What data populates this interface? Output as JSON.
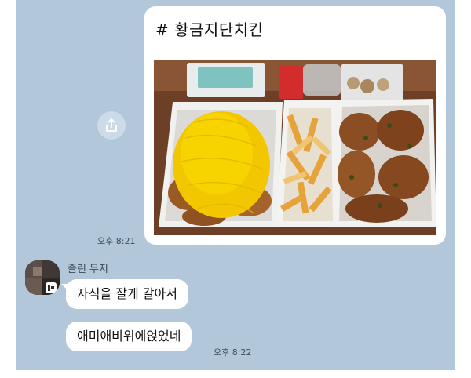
{
  "shared_card": {
    "title": "# 황금지단치킨",
    "time": "오후 8:21"
  },
  "incoming": {
    "sender": "졸린 무지",
    "messages": [
      {
        "text": "자식을 잘게 갈아서"
      },
      {
        "text": "애미애비위에얹었네"
      }
    ],
    "time": "오후 8:22"
  },
  "icons": {
    "share": "share-icon",
    "avatar_badge": "talk-badge-icon"
  },
  "colors": {
    "chat_background": "#b2c7da",
    "bubble": "#ffffff",
    "timestamp": "#3d4b57"
  }
}
